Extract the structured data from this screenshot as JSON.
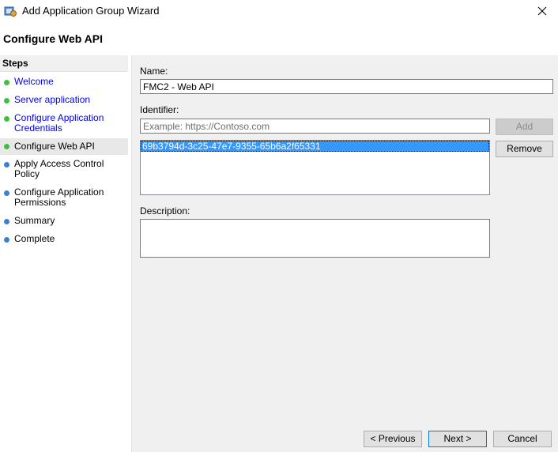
{
  "window": {
    "title": "Add Application Group Wizard"
  },
  "page_title": "Configure Web API",
  "steps": {
    "header": "Steps",
    "items": [
      {
        "label": "Welcome",
        "state": "done"
      },
      {
        "label": "Server application",
        "state": "done"
      },
      {
        "label": "Configure Application Credentials",
        "state": "done"
      },
      {
        "label": "Configure Web API",
        "state": "current"
      },
      {
        "label": "Apply Access Control Policy",
        "state": "pending"
      },
      {
        "label": "Configure Application Permissions",
        "state": "pending"
      },
      {
        "label": "Summary",
        "state": "pending"
      },
      {
        "label": "Complete",
        "state": "pending"
      }
    ]
  },
  "form": {
    "name_label": "Name:",
    "name_value": "FMC2 - Web API",
    "identifier_label": "Identifier:",
    "identifier_placeholder": "Example: https://Contoso.com",
    "add_label": "Add",
    "remove_label": "Remove",
    "identifiers": [
      "69b3794d-3c25-47e7-9355-65b6a2f65331"
    ],
    "description_label": "Description:",
    "description_value": ""
  },
  "footer": {
    "previous_label": "< Previous",
    "next_label": "Next >",
    "cancel_label": "Cancel"
  },
  "colors": {
    "done_dot": "#3fbf3f",
    "pending_dot": "#3c7fd9",
    "selection": "#3399ff",
    "link": "#0000ee"
  }
}
